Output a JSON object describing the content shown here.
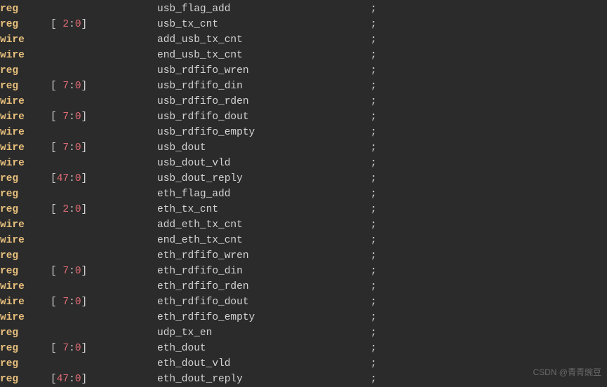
{
  "watermark": "CSDN @青青豌豆",
  "lines": [
    {
      "type": "reg",
      "range": null,
      "name": "usb_flag_add"
    },
    {
      "type": "reg",
      "range": "[ 2:0]",
      "name": "usb_tx_cnt"
    },
    {
      "type": "wire",
      "range": null,
      "name": "add_usb_tx_cnt"
    },
    {
      "type": "wire",
      "range": null,
      "name": "end_usb_tx_cnt"
    },
    {
      "type": "reg",
      "range": null,
      "name": "usb_rdfifo_wren"
    },
    {
      "type": "reg",
      "range": "[ 7:0]",
      "name": "usb_rdfifo_din"
    },
    {
      "type": "wire",
      "range": null,
      "name": "usb_rdfifo_rden"
    },
    {
      "type": "wire",
      "range": "[ 7:0]",
      "name": "usb_rdfifo_dout"
    },
    {
      "type": "wire",
      "range": null,
      "name": "usb_rdfifo_empty"
    },
    {
      "type": "wire",
      "range": "[ 7:0]",
      "name": "usb_dout"
    },
    {
      "type": "wire",
      "range": null,
      "name": "usb_dout_vld"
    },
    {
      "type": "reg",
      "range": "[47:0]",
      "name": "usb_dout_reply"
    },
    {
      "type": "reg",
      "range": null,
      "name": "eth_flag_add"
    },
    {
      "type": "reg",
      "range": "[ 2:0]",
      "name": "eth_tx_cnt"
    },
    {
      "type": "wire",
      "range": null,
      "name": "add_eth_tx_cnt"
    },
    {
      "type": "wire",
      "range": null,
      "name": "end_eth_tx_cnt"
    },
    {
      "type": "reg",
      "range": null,
      "name": "eth_rdfifo_wren"
    },
    {
      "type": "reg",
      "range": "[ 7:0]",
      "name": "eth_rdfifo_din"
    },
    {
      "type": "wire",
      "range": null,
      "name": "eth_rdfifo_rden"
    },
    {
      "type": "wire",
      "range": "[ 7:0]",
      "name": "eth_rdfifo_dout"
    },
    {
      "type": "wire",
      "range": null,
      "name": "eth_rdfifo_empty"
    },
    {
      "type": "reg",
      "range": null,
      "name": "udp_tx_en"
    },
    {
      "type": "reg",
      "range": "[ 7:0]",
      "name": "eth_dout"
    },
    {
      "type": "reg",
      "range": null,
      "name": "eth_dout_vld"
    },
    {
      "type": "reg",
      "range": "[47:0]",
      "name": "eth_dout_reply"
    }
  ]
}
